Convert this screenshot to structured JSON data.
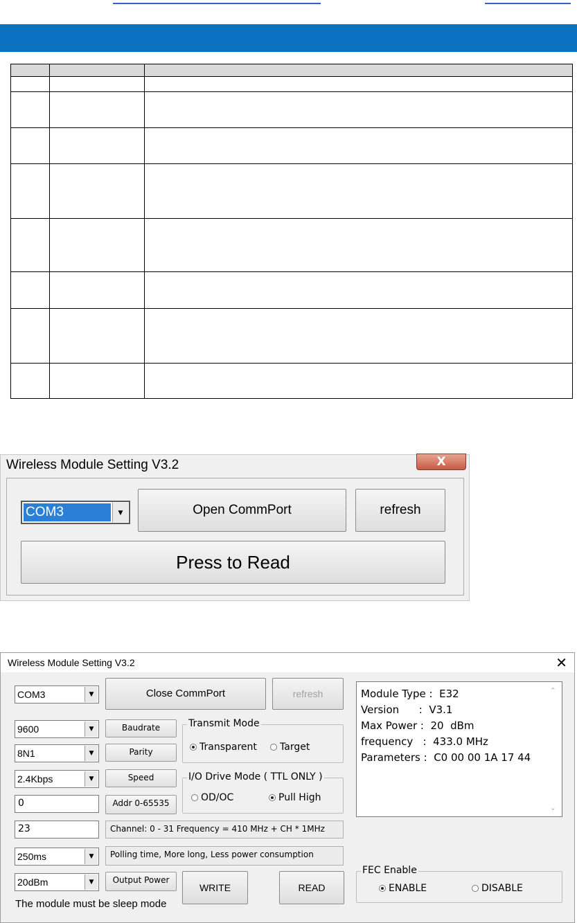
{
  "window1": {
    "title": "Wireless Module Setting V3.2",
    "close_glyph": "X",
    "port_value": "COM3",
    "open_button": "Open CommPort",
    "refresh_button": "refresh",
    "read_button": "Press to Read"
  },
  "window2": {
    "title": "Wireless Module Setting V3.2",
    "close_glyph": "✕",
    "port_value": "COM3",
    "close_port_button": "Close CommPort",
    "refresh_button": "refresh",
    "baud_value": "9600",
    "baud_button": "Baudrate",
    "parity_value": "8N1",
    "parity_button": "Parity",
    "speed_value": "2.4Kbps",
    "speed_button": "Speed",
    "addr_value": "0",
    "addr_button": "Addr 0-65535",
    "channel_value": "23",
    "channel_label": "Channel: 0 - 31 Frequency = 410 MHz + CH * 1MHz",
    "polling_value": "250ms",
    "polling_label": "Polling time, More long, Less power consumption",
    "power_value": "20dBm",
    "power_button": "Output Power",
    "sleep_note": "The module must be sleep mode",
    "write_button": "WRITE",
    "read_button": "READ",
    "transmit_group": "Transmit Mode",
    "transparent_label": "Transparent",
    "target_label": "Target",
    "io_group": "I/O Drive Mode ( TTL ONLY )",
    "odoc_label": "OD/OC",
    "pullhigh_label": "Pull High",
    "info": {
      "module_type": "Module Type :  E32",
      "version": "Version      :  V3.1",
      "max_power": "Max Power :  20  dBm",
      "frequency": "frequency   :  433.0 MHz",
      "parameters": "Parameters :  C0 00 00 1A 17 44"
    },
    "fec_group": "FEC Enable",
    "enable_label": "ENABLE",
    "disable_label": "DISABLE"
  },
  "colors": {
    "banner": "#0b73c2",
    "table_header": "#d9d9d9",
    "dialog_bg": "#f0f0f0",
    "combo_selected": "#2c7fd6"
  }
}
